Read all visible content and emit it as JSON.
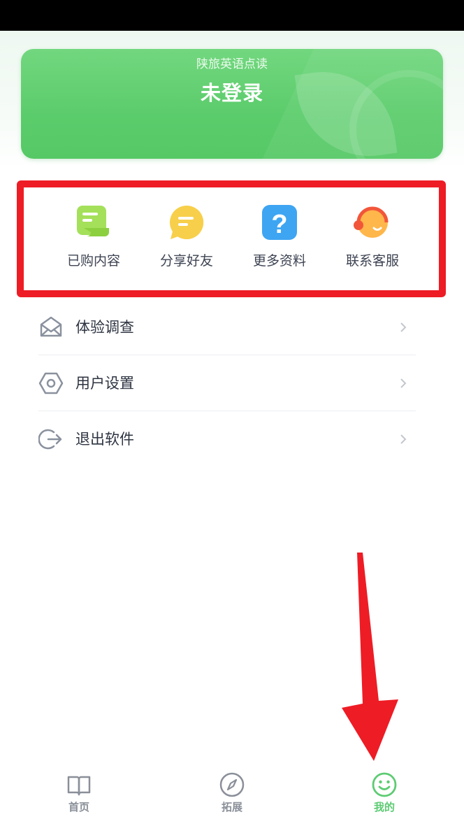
{
  "banner": {
    "subtitle": "陕旅英语点读",
    "title": "未登录"
  },
  "quick_actions": [
    {
      "label": "已购内容",
      "icon": "scroll-icon",
      "color": "#8dd44a"
    },
    {
      "label": "分享好友",
      "icon": "chat-bubble-icon",
      "color": "#f5c63a"
    },
    {
      "label": "更多资料",
      "icon": "question-icon",
      "color": "#3ea5f2"
    },
    {
      "label": "联系客服",
      "icon": "headset-icon",
      "color": "#f57a3f"
    }
  ],
  "menu": [
    {
      "label": "体验调查",
      "icon": "envelope-icon"
    },
    {
      "label": "用户设置",
      "icon": "hexagon-settings-icon"
    },
    {
      "label": "退出软件",
      "icon": "logout-icon"
    }
  ],
  "tabbar": {
    "tabs": [
      {
        "label": "首页",
        "icon": "book-icon",
        "active": false
      },
      {
        "label": "拓展",
        "icon": "compass-icon",
        "active": false
      },
      {
        "label": "我的",
        "icon": "smiley-icon",
        "active": true
      }
    ]
  },
  "colors": {
    "accent": "#5ccb72",
    "highlight_box": "#ee1c25"
  }
}
